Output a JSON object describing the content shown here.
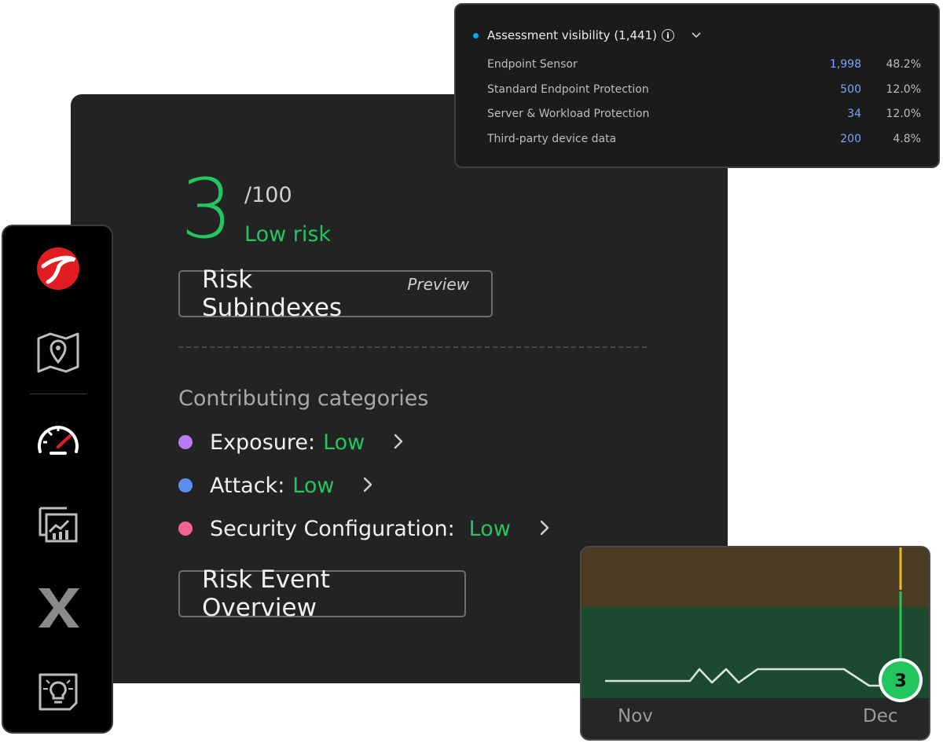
{
  "risk": {
    "score": "3",
    "max": "/100",
    "level": "Low risk",
    "subindex_label": "Risk Subindexes",
    "subindex_tag": "Preview",
    "overview_label": "Risk Event Overview"
  },
  "contributing": {
    "title": "Contributing categories",
    "items": [
      {
        "label": "Exposure:",
        "value": "Low",
        "color": "#b57bf0"
      },
      {
        "label": "Attack:",
        "value": "Low",
        "color": "#5b8def"
      },
      {
        "label": "Security Configuration:",
        "value": "Low",
        "color": "#f06292"
      }
    ]
  },
  "assessment": {
    "title": "Assessment visibility (1,441)",
    "rows": [
      {
        "label": "Endpoint Sensor",
        "count": "1,998",
        "pct": "48.2%"
      },
      {
        "label": "Standard Endpoint Protection",
        "count": "500",
        "pct": "12.0%"
      },
      {
        "label": "Server & Workload Protection",
        "count": "34",
        "pct": "12.0%"
      },
      {
        "label": "Third-party device data",
        "count": "200",
        "pct": "4.8%"
      }
    ]
  },
  "trend": {
    "current_value": "3",
    "x_labels": [
      "Nov",
      "Dec"
    ]
  },
  "sidebar": {
    "icons": [
      "trend-micro-logo-icon",
      "map-pin-icon",
      "speedometer-icon",
      "report-chart-icon",
      "x-icon",
      "lightbulb-doc-icon"
    ]
  },
  "colors": {
    "accent_green": "#22c55e",
    "card_bg": "#232323",
    "link_blue": "#7ba4ff",
    "brand_red": "#e11d24"
  }
}
